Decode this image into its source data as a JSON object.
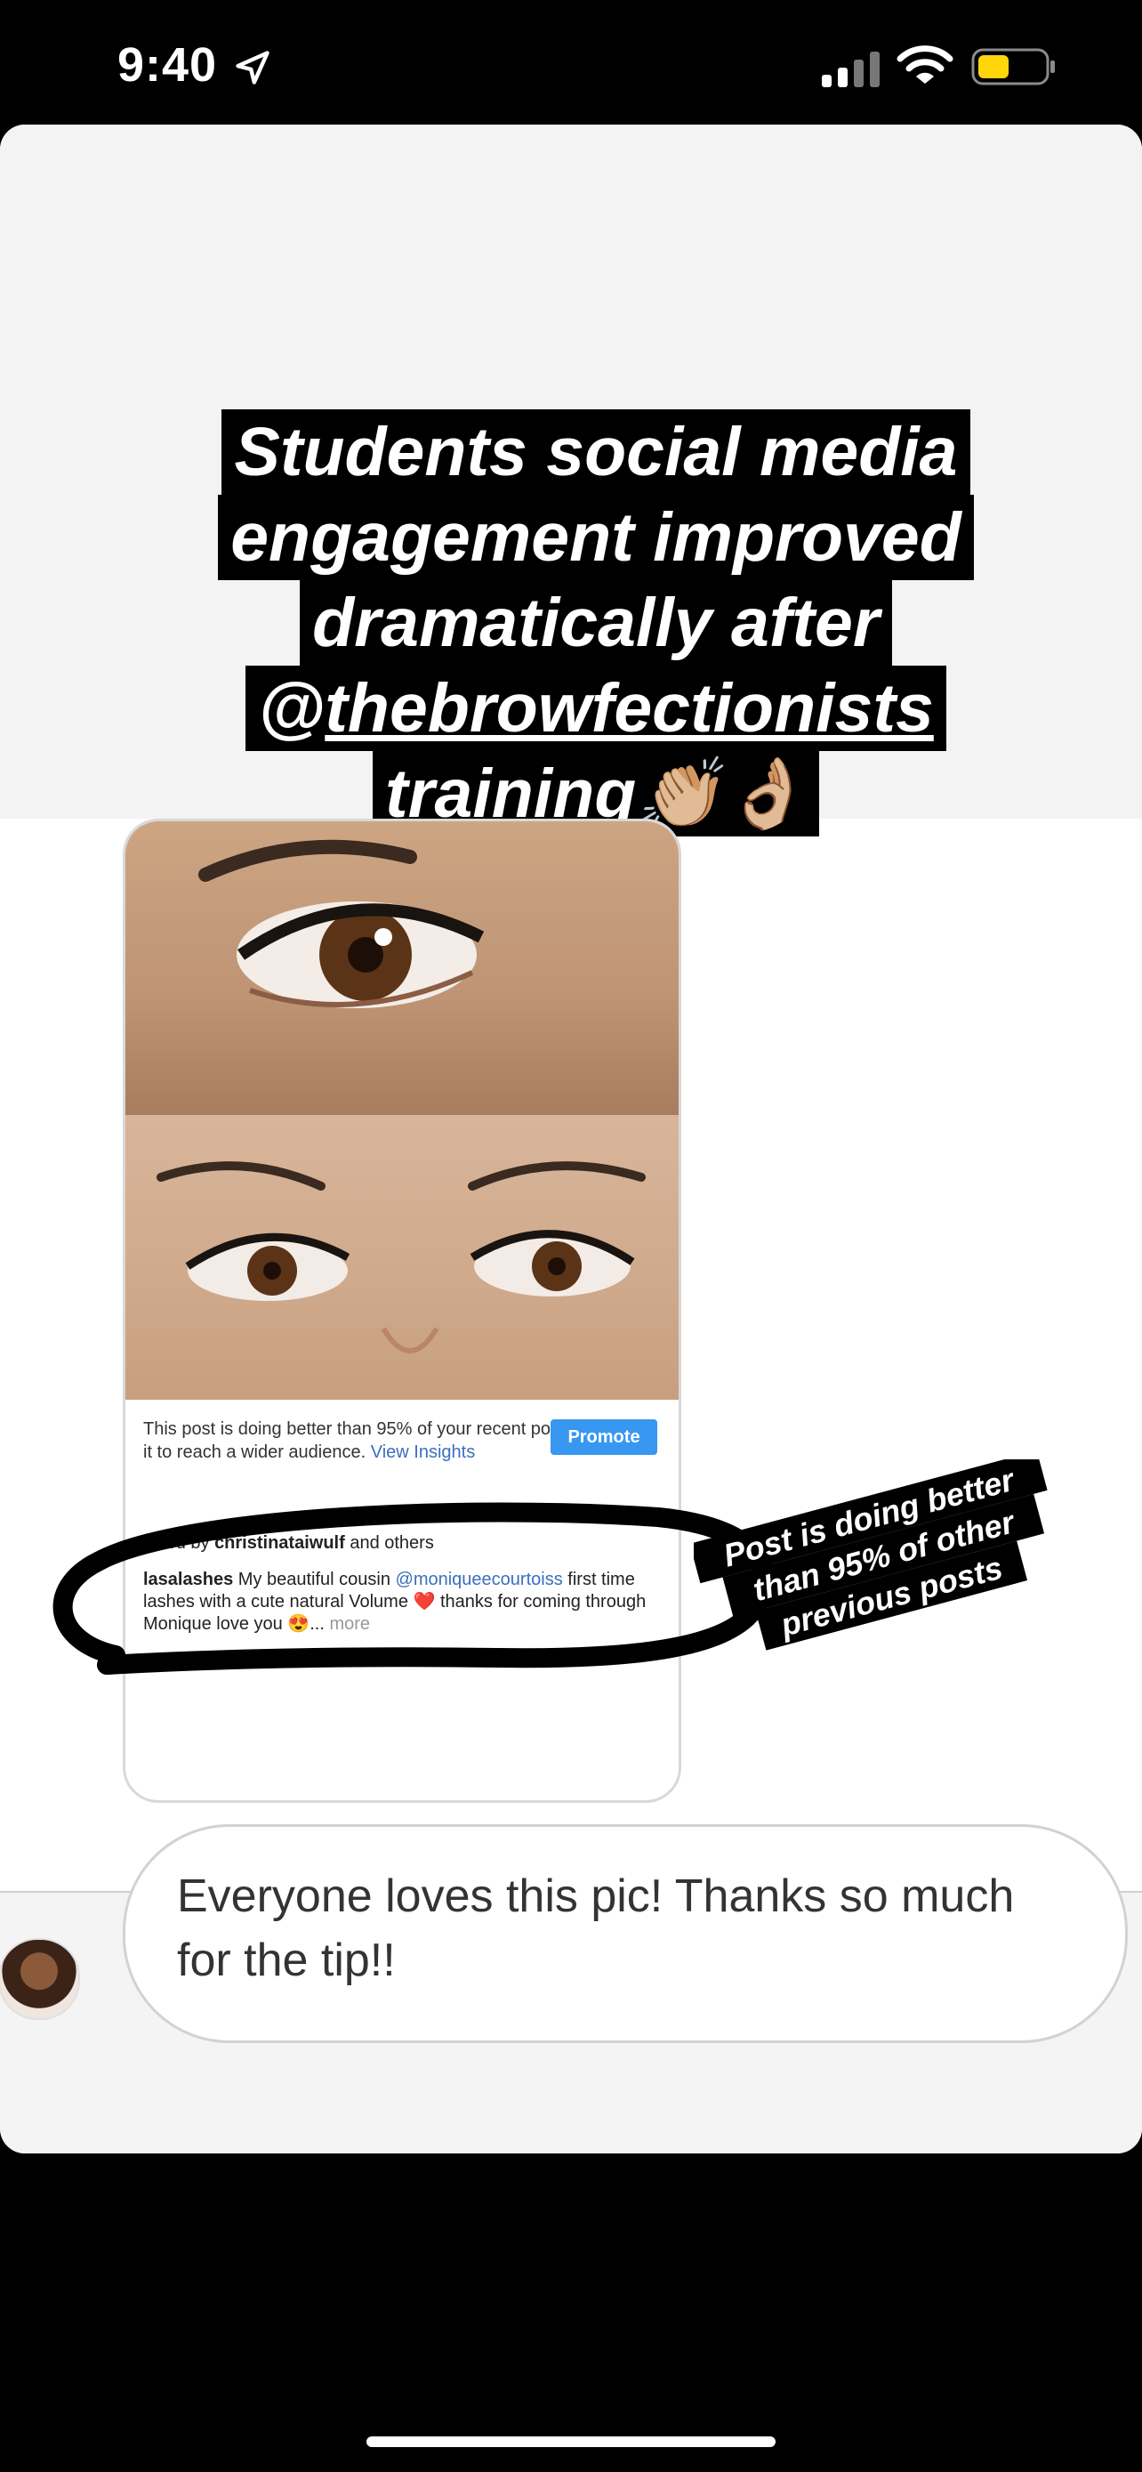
{
  "status_bar": {
    "time": "9:40"
  },
  "story": {
    "headline": {
      "line1": "Students social media",
      "line2": "engagement improved",
      "line3": "dramatically after",
      "line4_at": "@",
      "line4_handle": "thebrowfectionists",
      "line5": "training👏🏼👌🏼"
    },
    "post": {
      "insight_text": "This post is doing better than 95% of your recent posts. Promote it to reach a wider audience.",
      "insight_link": "View Insights",
      "promote_label": "Promote",
      "liked_by_prefix": "Liked by",
      "liked_by_user": "christinataiwulf",
      "liked_by_suffix": "and others",
      "caption_user": "lasalashes",
      "caption_text_1": "My beautiful cousin",
      "caption_mention": "@moniqueecourtoiss",
      "caption_text_2": "first time lashes with a cute natural Volume ❤️ thanks for coming through Monique love you 😍...",
      "caption_more": "more"
    },
    "sticker": {
      "line1": "Post is doing better",
      "line2": "than 95% of other",
      "line3": "previous posts"
    },
    "reply": {
      "text": "Everyone loves this pic! Thanks so much for the tip!!"
    }
  },
  "colors": {
    "promote_blue": "#3897f0",
    "mention_blue": "#3b6fbd"
  }
}
